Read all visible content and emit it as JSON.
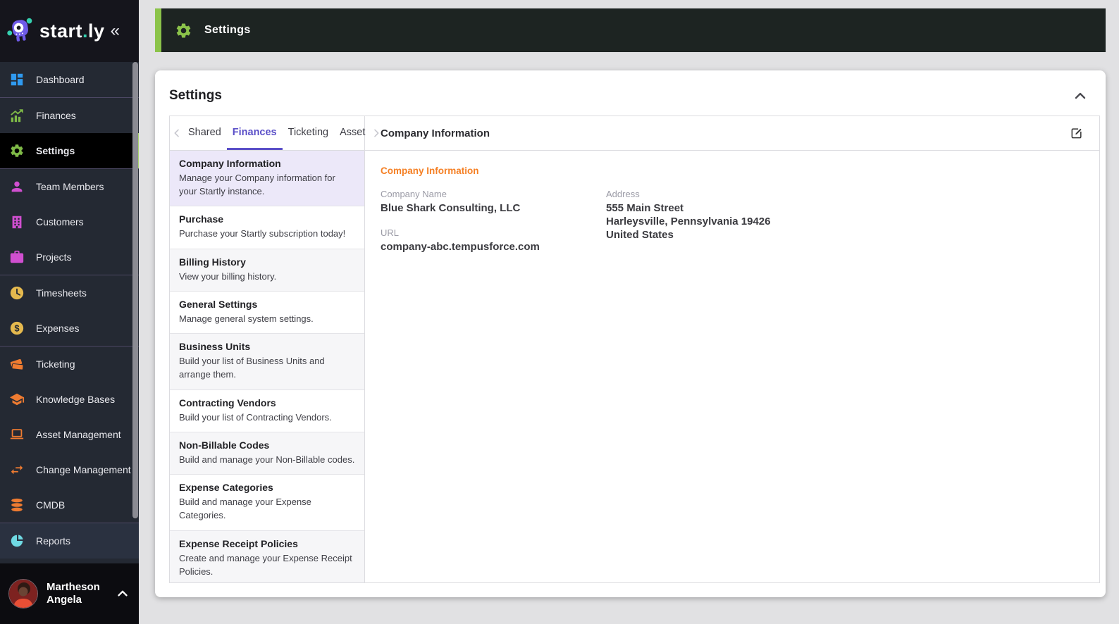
{
  "brand": {
    "name1": "start",
    "dot": ".",
    "name2": "ly",
    "collapse_glyph": "«"
  },
  "topbar": {
    "title": "Settings"
  },
  "sidebar": {
    "groups": [
      {
        "items": [
          {
            "label": "Dashboard",
            "icon": "dashboard-grid-icon",
            "color": "#2f9af0"
          }
        ]
      },
      {
        "items": [
          {
            "label": "Finances",
            "icon": "bar-chart-icon",
            "color": "#7fba47"
          },
          {
            "label": "Settings",
            "icon": "gear-icon",
            "color": "#7fba47",
            "active": true
          }
        ]
      },
      {
        "items": [
          {
            "label": "Team Members",
            "icon": "person-icon",
            "color": "#d04fd0"
          },
          {
            "label": "Customers",
            "icon": "building-icon",
            "color": "#d04fd0"
          },
          {
            "label": "Projects",
            "icon": "briefcase-icon",
            "color": "#d04fd0"
          }
        ]
      },
      {
        "items": [
          {
            "label": "Timesheets",
            "icon": "clock-icon",
            "color": "#e5b94e"
          },
          {
            "label": "Expenses",
            "icon": "dollar-circle-icon",
            "color": "#e5b94e"
          }
        ]
      },
      {
        "items": [
          {
            "label": "Ticketing",
            "icon": "tickets-icon",
            "color": "#ee7b31"
          },
          {
            "label": "Knowledge Bases",
            "icon": "graduation-cap-icon",
            "color": "#ee7b31"
          },
          {
            "label": "Asset Management",
            "icon": "laptop-icon",
            "color": "#ee7b31"
          },
          {
            "label": "Change Management",
            "icon": "swap-arrows-icon",
            "color": "#ee7b31"
          },
          {
            "label": "CMDB",
            "icon": "database-icon",
            "color": "#ee7b31"
          }
        ]
      },
      {
        "items": [
          {
            "label": "Reports",
            "icon": "pie-chart-icon",
            "color": "#6fd9e3"
          }
        ]
      }
    ],
    "dollar_glyph": "$",
    "user": {
      "name_line1": "Martheson",
      "name_line2": "Angela"
    }
  },
  "settings_card": {
    "title": "Settings",
    "tabs": {
      "labels": [
        "Shared",
        "Finances",
        "Ticketing",
        "Asset"
      ],
      "active": "Finances"
    },
    "sections": [
      {
        "title": "Company Information",
        "desc": "Manage your Company information for your Startly instance.",
        "selected": true
      },
      {
        "title": "Purchase",
        "desc": "Purchase your Startly subscription today!"
      },
      {
        "title": "Billing History",
        "desc": "View your billing history."
      },
      {
        "title": "General Settings",
        "desc": "Manage general system settings."
      },
      {
        "title": "Business Units",
        "desc": "Build your list of Business Units and arrange them."
      },
      {
        "title": "Contracting Vendors",
        "desc": "Build your list of Contracting Vendors."
      },
      {
        "title": "Non-Billable Codes",
        "desc": "Build and manage your Non-Billable codes."
      },
      {
        "title": "Expense Categories",
        "desc": "Build and manage your Expense Categories."
      },
      {
        "title": "Expense Receipt Policies",
        "desc": "Create and manage your Expense Receipt Policies."
      }
    ],
    "detail": {
      "header": "Company Information",
      "section_heading": "Company Information",
      "company_name_label": "Company Name",
      "company_name_value": "Blue Shark Consulting, LLC",
      "url_label": "URL",
      "url_value": "company-abc.tempusforce.com",
      "address_label": "Address",
      "address_line1": "555 Main Street",
      "address_line2": "Harleysville, Pennsylvania 19426",
      "address_line3": "United States"
    }
  },
  "colors": {
    "accent_green": "#8bc34a",
    "active_indicator_green": "#a8d36f",
    "tab_active_purple": "#5b50c8",
    "selected_row_bg": "#ece8f9",
    "orange_heading": "#f58025"
  }
}
